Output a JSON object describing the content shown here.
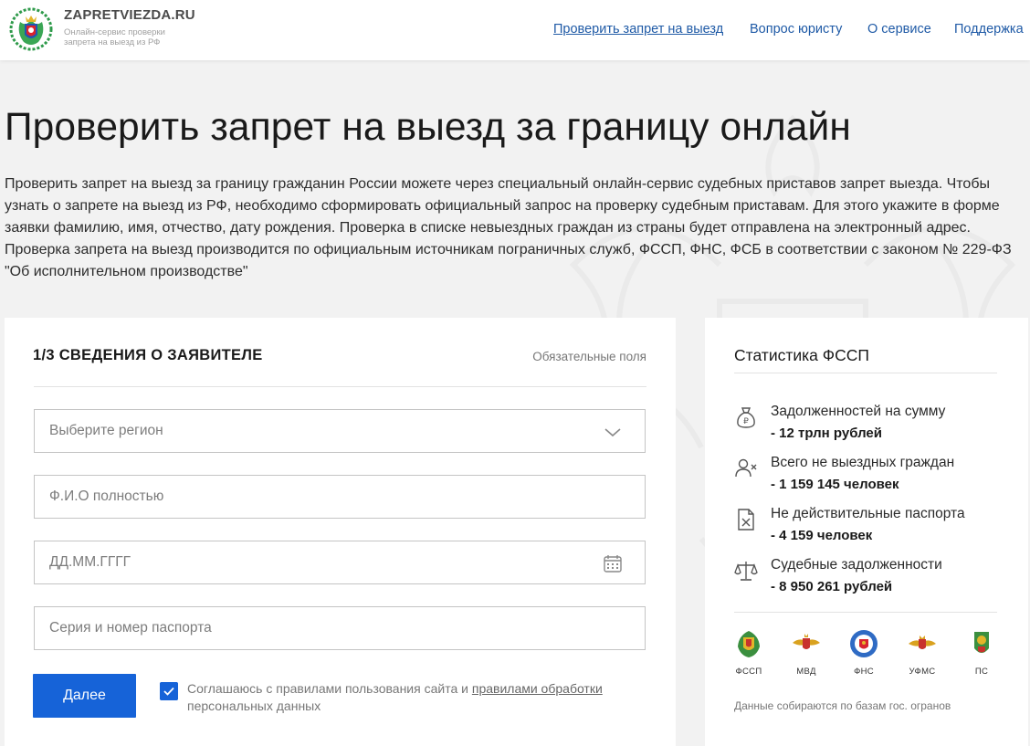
{
  "header": {
    "brand_name": "ZAPRETVIEZDA.RU",
    "brand_tagline": "Онлайн-сервис проверки запрета на выезд из РФ",
    "nav": [
      {
        "label": "Проверить запрет на выезд",
        "active": true
      },
      {
        "label": "Вопрос юристу",
        "active": false
      },
      {
        "label": "О сервисе",
        "active": false
      },
      {
        "label": "Поддержка",
        "active": false
      }
    ]
  },
  "hero": {
    "title": "Проверить запрет на выезд за границу онлайн",
    "intro": "Проверить запрет на выезд за границу гражданин России можете через специальный онлайн-сервис судебных приставов запрет выезда. Чтобы узнать о запрете на выезд из РФ, необходимо сформировать официальный запрос на проверку судебным приставам. Для этого укажите в форме заявки фамилию, имя, отчество, дату рождения. Проверка в списке невыездных граждан из страны будет отправлена на электронный адрес. Проверка запрета на выезд производится по официальным источникам пограничных служб, ФССП, ФНС, ФСБ в соответствии с законом № 229-ФЗ \"Об исполнительном производстве\""
  },
  "form": {
    "step_title": "1/3 СВЕДЕНИЯ О ЗАЯВИТЕЛЕ",
    "required_note": "Обязательные поля",
    "region_placeholder": "Выберите регион",
    "fio_placeholder": "Ф.И.О полностью",
    "date_placeholder": "ДД.ММ.ГГГГ",
    "passport_placeholder": "Серия и номер паспорта",
    "submit_label": "Далее",
    "consent_checked": true,
    "consent_text": "Соглашаюсь с правилами пользования сайта и ",
    "consent_link": "правилами обработки",
    "consent_tail": "персональных данных"
  },
  "stats": {
    "title": "Статистика ФССП",
    "items": [
      {
        "icon": "ruble-bag-icon",
        "label": "Задолженностей на сумму",
        "value": "- 12 трлн рублей"
      },
      {
        "icon": "user-x-icon",
        "label": "Всего не выездных граждан",
        "value": "- 1 159 145 человек"
      },
      {
        "icon": "document-x-icon",
        "label": "Не действительные паспорта",
        "value": "- 4 159 человек"
      },
      {
        "icon": "scales-icon",
        "label": "Судебные задолженности",
        "value": "- 8 950 261 рублей"
      }
    ],
    "agencies": [
      {
        "label": "ФССП",
        "icon": "fssp-emblem-icon"
      },
      {
        "label": "МВД",
        "icon": "mvd-emblem-icon"
      },
      {
        "label": "ФНС",
        "icon": "fns-emblem-icon"
      },
      {
        "label": "УФМС",
        "icon": "ufms-emblem-icon"
      },
      {
        "label": "ПС",
        "icon": "ps-emblem-icon"
      }
    ],
    "footer": "Данные собираются по базам гос. огранов"
  },
  "colors": {
    "accent": "#1663d8",
    "link": "#1f5aa6",
    "background": "#f2f2f2"
  }
}
